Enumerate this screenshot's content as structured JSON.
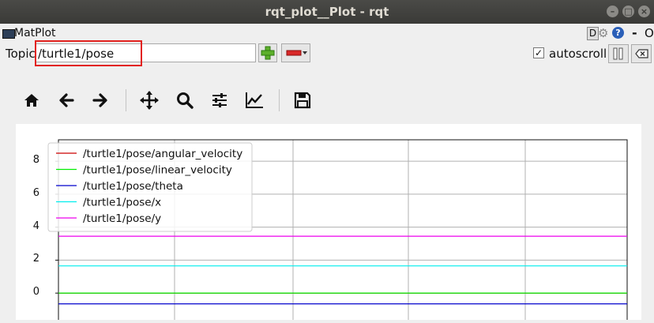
{
  "window": {
    "title": "rqt_plot__Plot - rqt",
    "plugin_name": "MatPlot",
    "d_button": "D",
    "help_label": "?",
    "dash_label": "-",
    "o_label": "O"
  },
  "controls": {
    "topic_label": "Topic",
    "topic_value": "/turtle1/pose",
    "autoscroll_label": "autoscroll",
    "autoscroll_checked": true
  },
  "toolbar": {
    "icons": [
      "home-icon",
      "back-arrow-icon",
      "forward-arrow-icon",
      "pan-icon",
      "zoom-icon",
      "subplot-config-icon",
      "edit-curves-icon",
      "save-icon"
    ]
  },
  "chart_data": {
    "type": "line",
    "title": "",
    "xlabel": "",
    "ylabel": "",
    "xlim": [
      0,
      1
    ],
    "ylim": [
      -2.1,
      9.3
    ],
    "yticks": [
      0,
      2,
      4,
      6,
      8
    ],
    "grid": true,
    "legend_position": "top-left",
    "series": [
      {
        "name": "/turtle1/pose/angular_velocity",
        "color": "#cc0000",
        "x": [
          0,
          1
        ],
        "values": [
          0.0,
          0.0
        ]
      },
      {
        "name": "/turtle1/pose/linear_velocity",
        "color": "#00ee00",
        "x": [
          0,
          1
        ],
        "values": [
          0.0,
          0.0
        ]
      },
      {
        "name": "/turtle1/pose/theta",
        "color": "#0000cc",
        "x": [
          0,
          1
        ],
        "values": [
          -0.65,
          -0.65
        ]
      },
      {
        "name": "/turtle1/pose/x",
        "color": "#00eeee",
        "x": [
          0,
          1
        ],
        "values": [
          1.65,
          1.65
        ]
      },
      {
        "name": "/turtle1/pose/y",
        "color": "#ee00ee",
        "x": [
          0,
          1
        ],
        "values": [
          3.45,
          3.45
        ]
      }
    ]
  }
}
